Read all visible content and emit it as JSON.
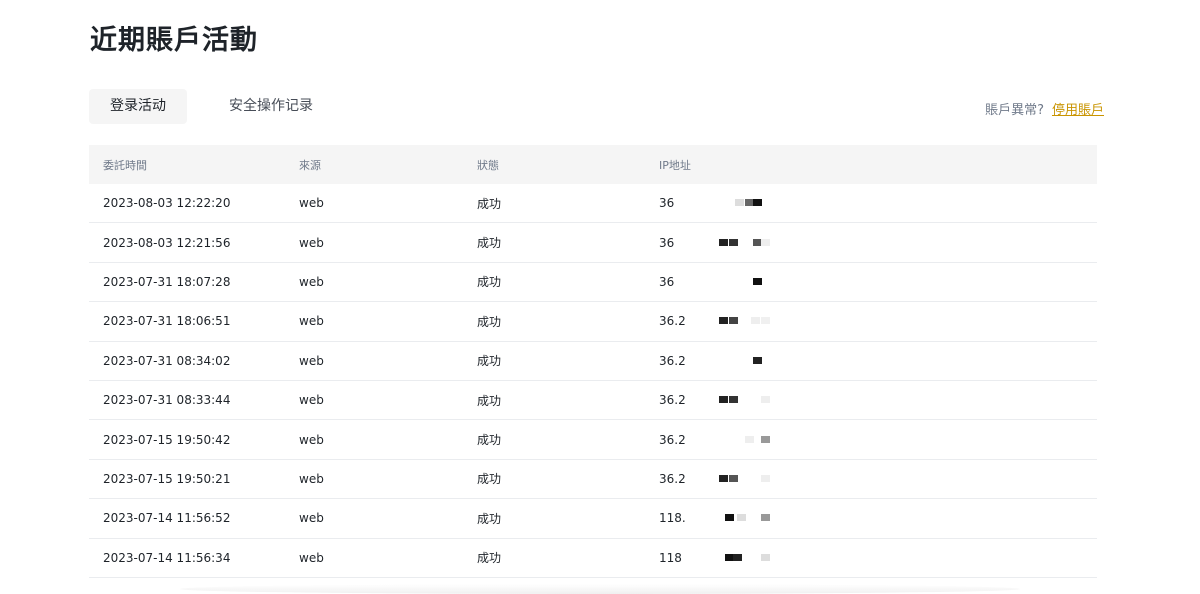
{
  "page": {
    "title": "近期賬戶活動"
  },
  "tabs": [
    {
      "label": "登录活动",
      "active": true
    },
    {
      "label": "安全操作记录",
      "active": false
    }
  ],
  "anomaly": {
    "prompt": "賬戶異常?",
    "link_label": "停用賬戶"
  },
  "table": {
    "headers": [
      "委託時間",
      "來源",
      "狀態",
      "IP地址"
    ],
    "rows": [
      {
        "time": "2023-08-03 12:22:20",
        "source": "web",
        "status": "成功",
        "ip": "36"
      },
      {
        "time": "2023-08-03 12:21:56",
        "source": "web",
        "status": "成功",
        "ip": "36"
      },
      {
        "time": "2023-07-31 18:07:28",
        "source": "web",
        "status": "成功",
        "ip": "36"
      },
      {
        "time": "2023-07-31 18:06:51",
        "source": "web",
        "status": "成功",
        "ip": "36.2"
      },
      {
        "time": "2023-07-31 08:34:02",
        "source": "web",
        "status": "成功",
        "ip": "36.2"
      },
      {
        "time": "2023-07-31 08:33:44",
        "source": "web",
        "status": "成功",
        "ip": "36.2"
      },
      {
        "time": "2023-07-15 19:50:42",
        "source": "web",
        "status": "成功",
        "ip": "36.2"
      },
      {
        "time": "2023-07-15 19:50:21",
        "source": "web",
        "status": "成功",
        "ip": "36.2"
      },
      {
        "time": "2023-07-14 11:56:52",
        "source": "web",
        "status": "成功",
        "ip": "118."
      },
      {
        "time": "2023-07-14 11:56:34",
        "source": "web",
        "status": "成功",
        "ip": "118"
      }
    ]
  },
  "colors": {
    "accent": "#c99400",
    "header_bg": "#f5f5f5",
    "text": "#1e2329",
    "muted": "#707a8a"
  }
}
